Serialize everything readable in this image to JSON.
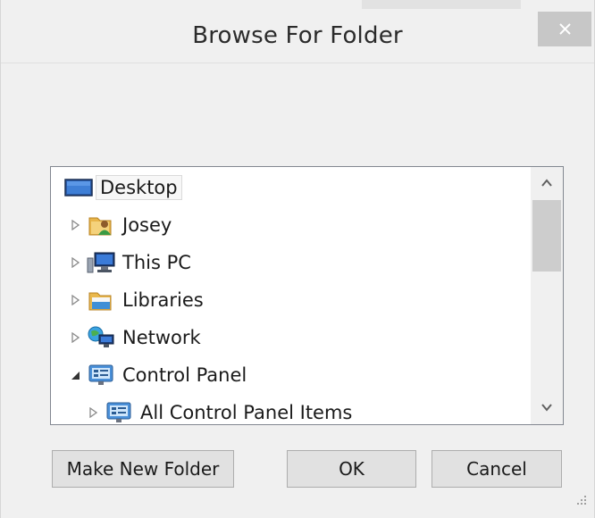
{
  "window": {
    "title": "Browse For Folder",
    "close_icon": "close-icon"
  },
  "tree": {
    "items": [
      {
        "label": "Desktop",
        "icon": "desktop-icon",
        "expander": "none",
        "selected": true
      },
      {
        "label": "Josey",
        "icon": "user-folder-icon",
        "expander": "collapsed"
      },
      {
        "label": "This PC",
        "icon": "computer-icon",
        "expander": "collapsed"
      },
      {
        "label": "Libraries",
        "icon": "libraries-icon",
        "expander": "collapsed"
      },
      {
        "label": "Network",
        "icon": "network-icon",
        "expander": "collapsed"
      },
      {
        "label": "Control Panel",
        "icon": "control-panel-icon",
        "expander": "expanded"
      },
      {
        "label": "All Control Panel Items",
        "icon": "control-panel-icon",
        "expander": "collapsed"
      }
    ]
  },
  "scrollbar": {
    "up_icon": "scroll-up-arrow-icon",
    "down_icon": "scroll-down-arrow-icon"
  },
  "buttons": {
    "make_new_folder": "Make New Folder",
    "ok": "OK",
    "cancel": "Cancel"
  },
  "colors": {
    "selection_border": "#dadada",
    "close_bg": "#c7c7c7",
    "button_bg": "#e1e1e1"
  }
}
